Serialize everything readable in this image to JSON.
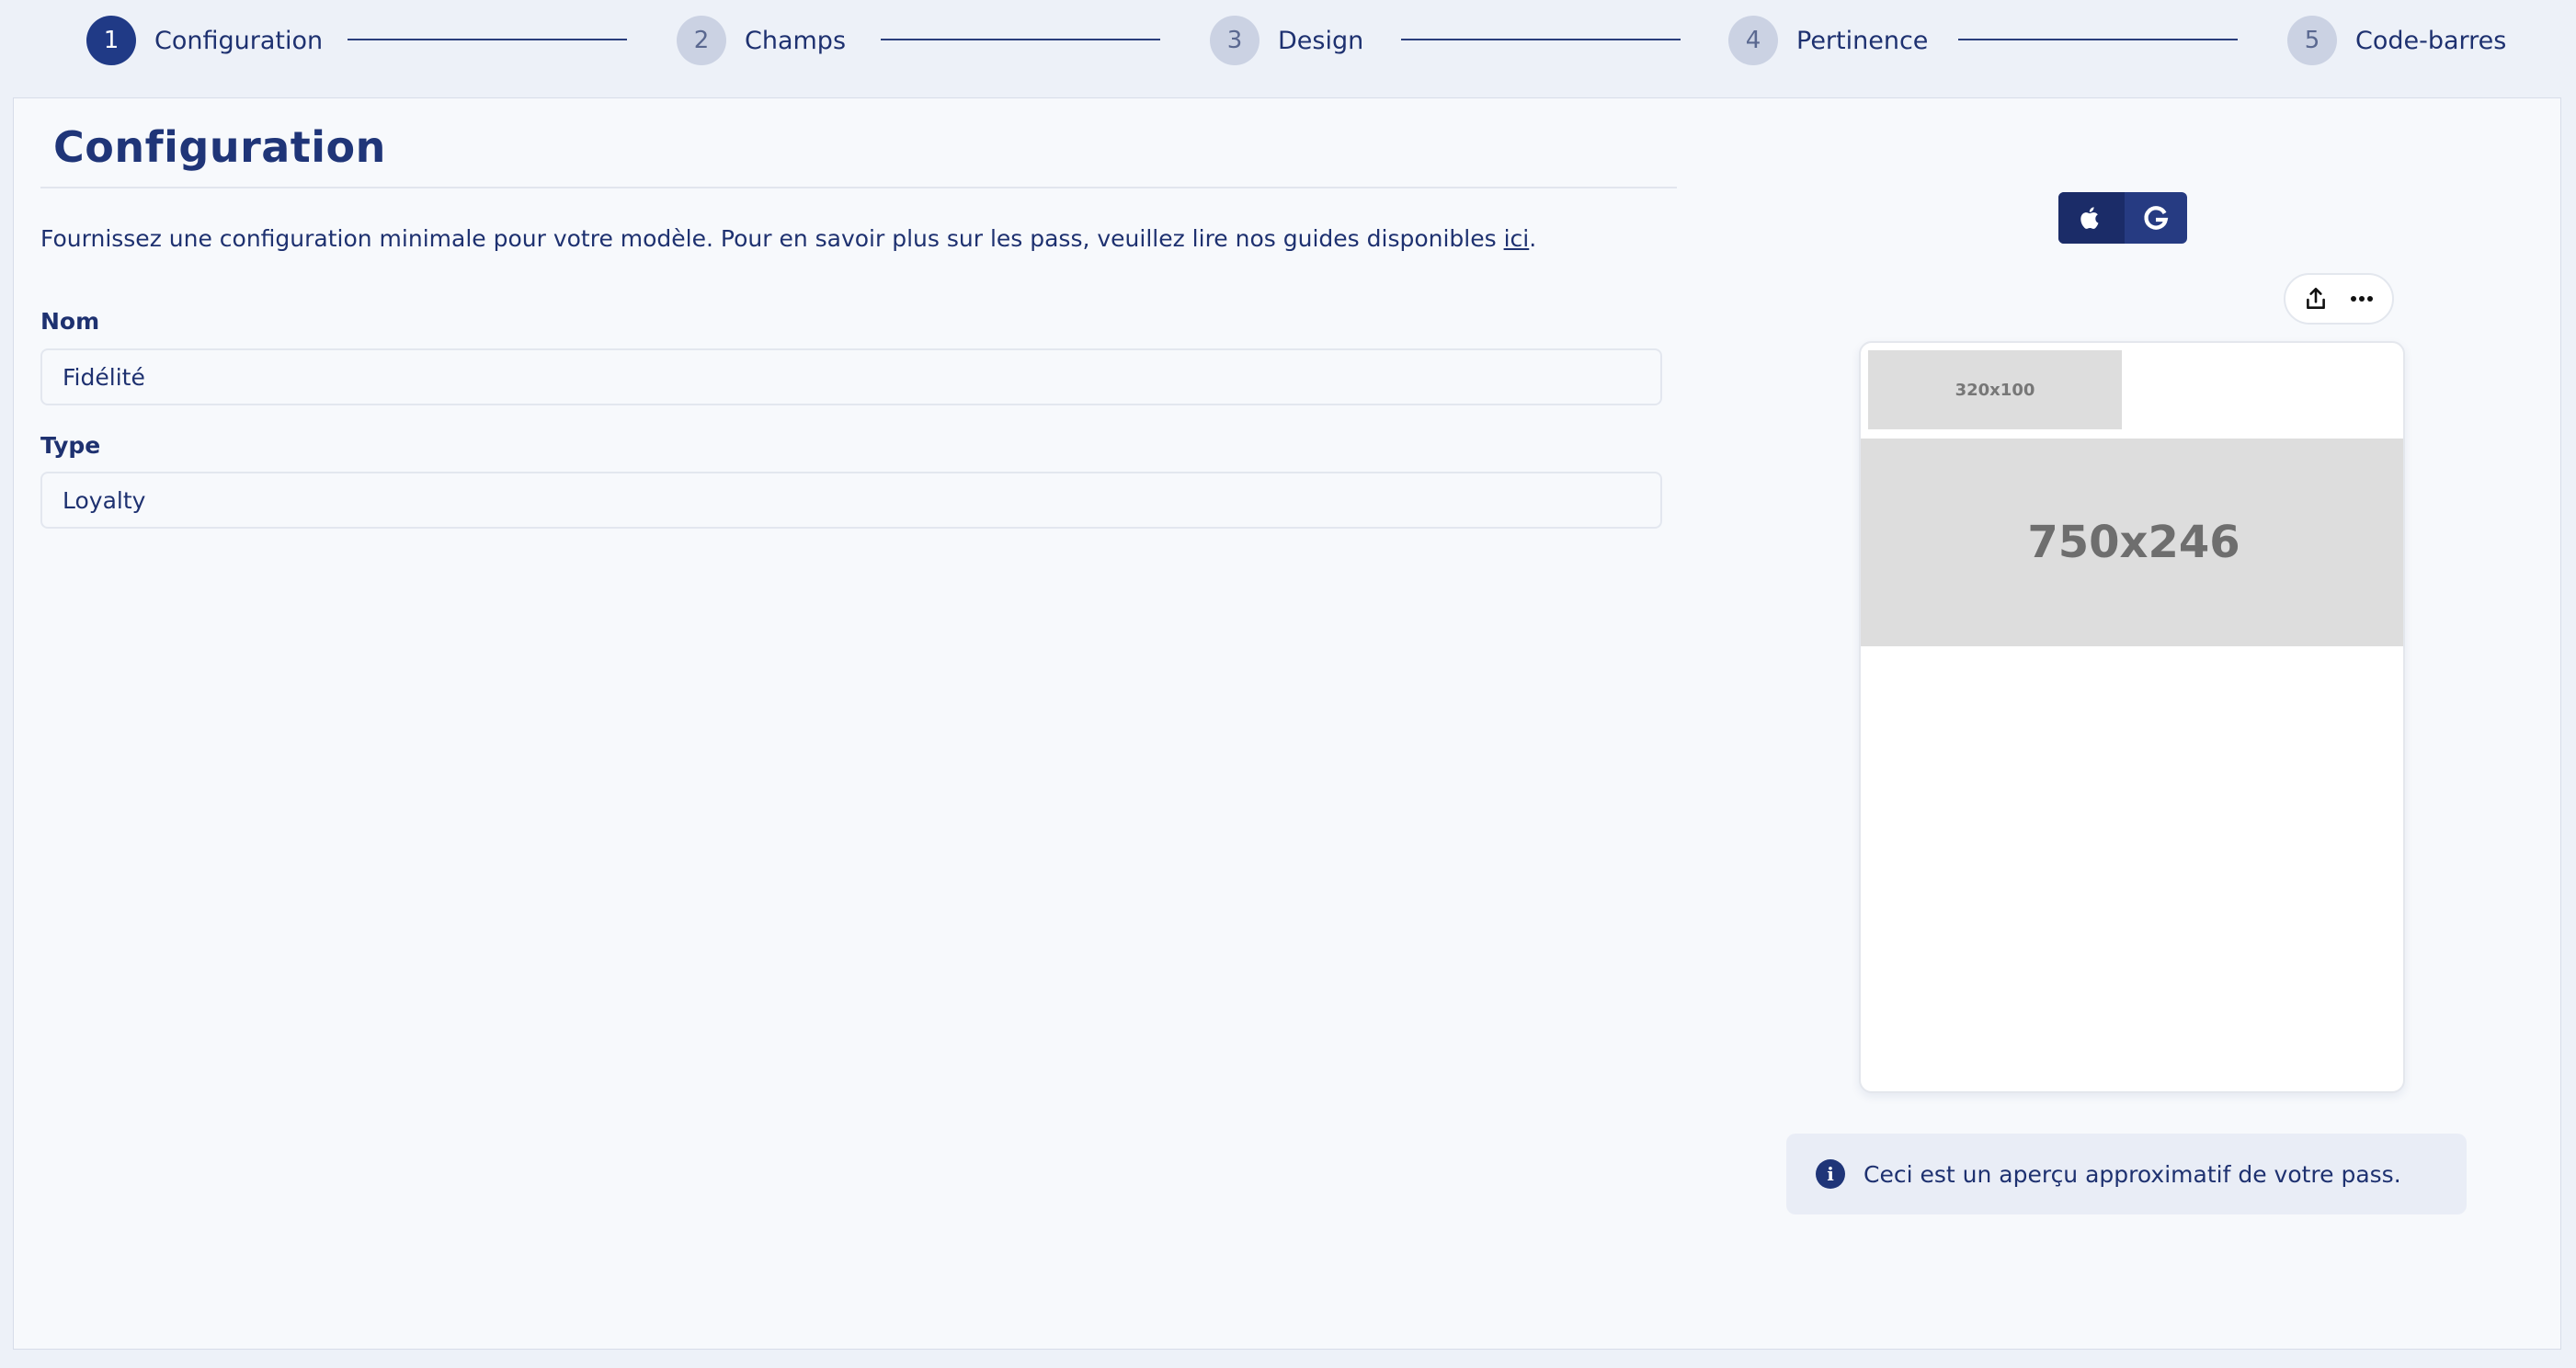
{
  "stepper": {
    "steps": [
      {
        "number": "1",
        "label": "Configuration",
        "active": true
      },
      {
        "number": "2",
        "label": "Champs",
        "active": false
      },
      {
        "number": "3",
        "label": "Design",
        "active": false
      },
      {
        "number": "4",
        "label": "Pertinence",
        "active": false
      },
      {
        "number": "5",
        "label": "Code-barres",
        "active": false
      }
    ]
  },
  "main": {
    "title": "Configuration",
    "intro_text": "Fournissez une configuration minimale pour votre modèle. Pour en savoir plus sur les pass, veuillez lire nos guides disponibles ",
    "intro_link": "ici",
    "intro_end": ".",
    "fields": {
      "name": {
        "label": "Nom",
        "value": "Fidélité"
      },
      "type": {
        "label": "Type",
        "value": "Loyalty"
      }
    }
  },
  "preview": {
    "platforms": [
      {
        "name": "apple",
        "icon": "apple-icon",
        "selected": true
      },
      {
        "name": "google",
        "icon": "google-icon",
        "selected": false
      }
    ],
    "toolbar": {
      "share_icon": "share-icon",
      "more_icon": "more-icon"
    },
    "logo_placeholder": "320x100",
    "strip_placeholder": "750x246",
    "info_text": "Ceci est un aperçu approximatif de votre pass."
  },
  "colors": {
    "primary": "#203a86",
    "text": "#1e3170",
    "inactive_step": "#cbd2e3",
    "background": "#edf1f8",
    "panel": "#f7f9fc"
  }
}
